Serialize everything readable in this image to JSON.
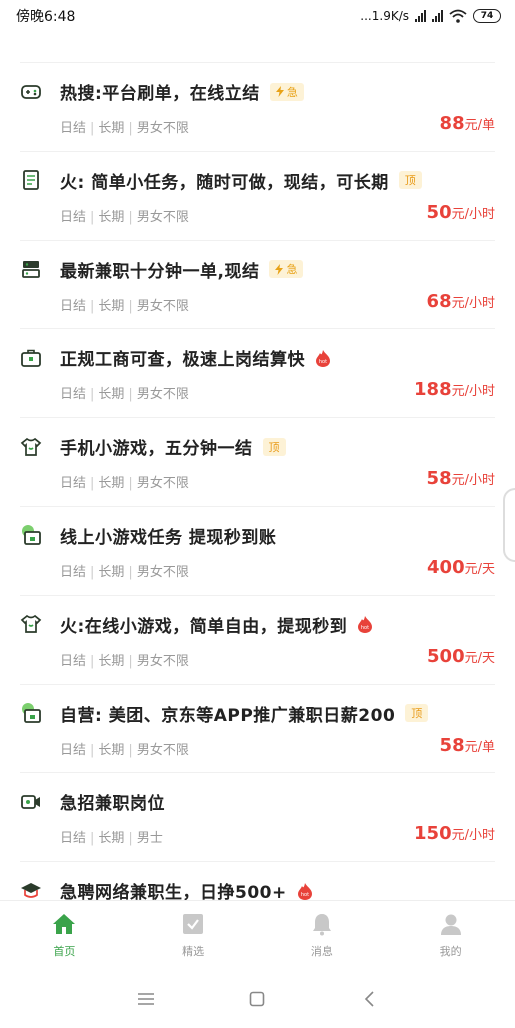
{
  "status_bar": {
    "time": "傍晚6:48",
    "network_speed": "...1.9K/s",
    "network_type": "HD",
    "battery": "74"
  },
  "jobs": [
    {
      "icon": "gamepad-icon",
      "title": "热搜:平台刷单，在线立结",
      "tag": "urgent",
      "tag_label": "急",
      "meta": [
        "日结",
        "长期",
        "男女不限"
      ],
      "price": "88",
      "unit": "元/单"
    },
    {
      "icon": "document-icon",
      "title": "火: 简单小任务，随时可做，现结，可长期",
      "tag": "top",
      "tag_label": "顶",
      "meta": [
        "日结",
        "长期",
        "男女不限"
      ],
      "price": "50",
      "unit": "元/小时"
    },
    {
      "icon": "server-icon",
      "title": "最新兼职十分钟一单,现结",
      "tag": "urgent",
      "tag_label": "急",
      "meta": [
        "日结",
        "长期",
        "男女不限"
      ],
      "price": "68",
      "unit": "元/小时"
    },
    {
      "icon": "briefcase-icon",
      "title": "正规工商可查，极速上岗结算快",
      "tag": "hot",
      "tag_label": "hot",
      "meta": [
        "日结",
        "长期",
        "男女不限"
      ],
      "price": "188",
      "unit": "元/小时"
    },
    {
      "icon": "tshirt-icon",
      "title": "手机小游戏，五分钟一结",
      "tag": "top",
      "tag_label": "顶",
      "meta": [
        "日结",
        "长期",
        "男女不限"
      ],
      "price": "58",
      "unit": "元/小时"
    },
    {
      "icon": "shop-icon",
      "title": "线上小游戏任务 提现秒到账",
      "tag": "",
      "tag_label": "",
      "meta": [
        "日结",
        "长期",
        "男女不限"
      ],
      "price": "400",
      "unit": "元/天"
    },
    {
      "icon": "tshirt-icon",
      "title": "火:在线小游戏，简单自由，提现秒到",
      "tag": "hot",
      "tag_label": "hot",
      "meta": [
        "日结",
        "长期",
        "男女不限"
      ],
      "price": "500",
      "unit": "元/天"
    },
    {
      "icon": "shop-icon",
      "title": "自营: 美团、京东等APP推广兼职日薪200",
      "tag": "top",
      "tag_label": "顶",
      "meta": [
        "日结",
        "长期",
        "男女不限"
      ],
      "price": "58",
      "unit": "元/单"
    },
    {
      "icon": "video-icon",
      "title": "急招兼职岗位",
      "tag": "",
      "tag_label": "",
      "meta": [
        "日结",
        "长期",
        "男士"
      ],
      "price": "150",
      "unit": "元/小时"
    },
    {
      "icon": "graduation-cap-icon",
      "title": "急聘网络兼职生，日挣500+",
      "tag": "hot",
      "tag_label": "hot",
      "meta": [],
      "price": "",
      "unit": ""
    }
  ],
  "tabbar": {
    "tabs": [
      {
        "label": "首页",
        "icon": "home-icon",
        "active": true
      },
      {
        "label": "精选",
        "icon": "featured-icon",
        "active": false
      },
      {
        "label": "消息",
        "icon": "bell-icon",
        "active": false
      },
      {
        "label": "我的",
        "icon": "user-icon",
        "active": false
      }
    ]
  },
  "colors": {
    "accent_green": "#3aa34a",
    "price_red": "#e8423a",
    "tag_orange": "#e8a217"
  }
}
